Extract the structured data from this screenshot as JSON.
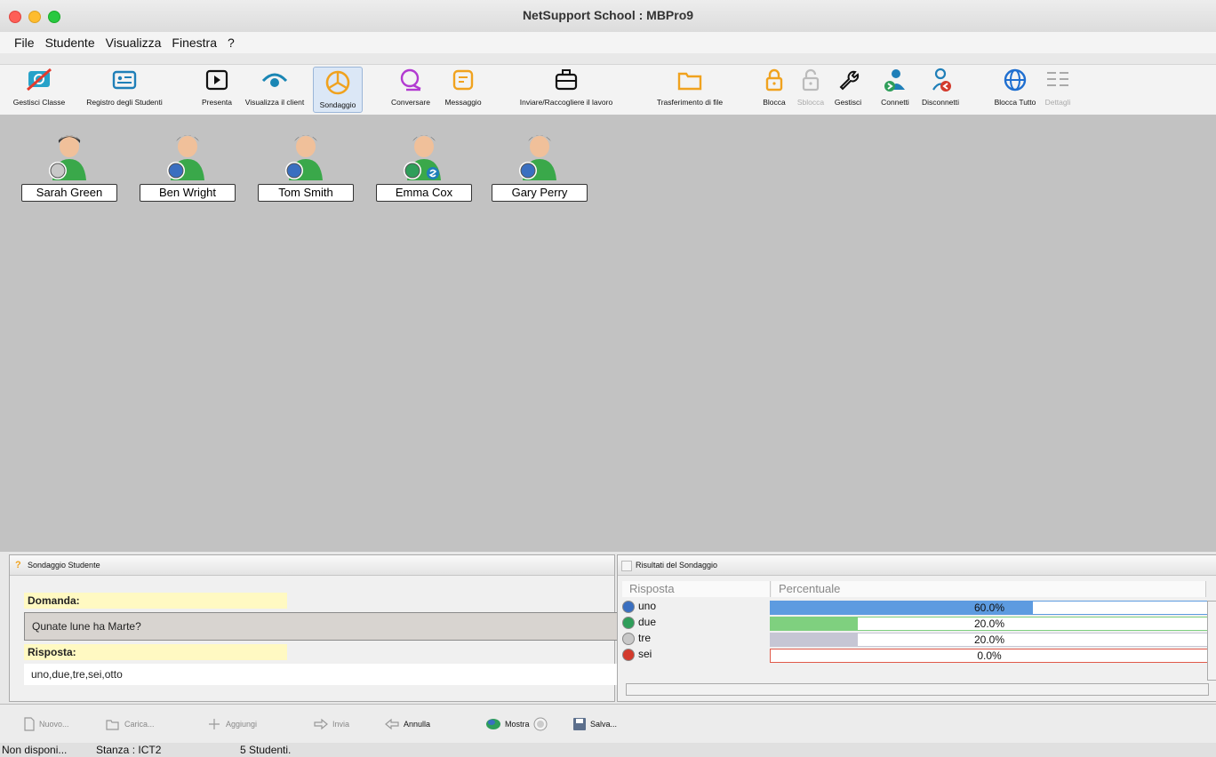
{
  "window": {
    "title": "NetSupport School : MBPro9"
  },
  "menu": [
    "File",
    "Studente",
    "Visualizza",
    "Finestra",
    "?"
  ],
  "toolbar": {
    "gestisci_classe": "Gestisci Classe",
    "registro": "Registro degli Studenti",
    "presenta": "Presenta",
    "visualizza_client": "Visualizza il client",
    "sondaggio": "Sondaggio",
    "conversare": "Conversare",
    "messaggio": "Messaggio",
    "inviare": "Inviare/Raccogliere il lavoro",
    "trasferimento": "Trasferimento di file",
    "blocca": "Blocca",
    "sblocca": "Sblocca",
    "gestisci": "Gestisci",
    "connetti": "Connetti",
    "disconnetti": "Disconnetti",
    "blocca_tutto": "Blocca Tutto",
    "dettagli": "Dettagli"
  },
  "students": [
    {
      "name": "Sarah Green",
      "answer_color": "#c8c8c8"
    },
    {
      "name": "Ben Wright",
      "answer_color": "#3a6fc0"
    },
    {
      "name": "Tom Smith",
      "answer_color": "#3a6fc0"
    },
    {
      "name": "Emma Cox",
      "answer_color": "#2f9e5a"
    },
    {
      "name": "Gary Perry",
      "answer_color": "#3a6fc0"
    }
  ],
  "survey": {
    "panel_title": "Sondaggio Studente",
    "question_label": "Domanda:",
    "question": "Qunate lune ha Marte?",
    "answer_label": "Risposta:",
    "answers": "uno,due,tre,sei,otto"
  },
  "results": {
    "panel_title": "Risultati del Sondaggio",
    "col_answer": "Risposta",
    "col_percent": "Percentuale",
    "rows": [
      {
        "answer": "uno",
        "percent": "60.0%",
        "fraction": 0.6,
        "color": "#5d9be0",
        "dot": "#3a6fc0"
      },
      {
        "answer": "due",
        "percent": "20.0%",
        "fraction": 0.2,
        "color": "#7fd07f",
        "dot": "#2f9e5a"
      },
      {
        "answer": "tre",
        "percent": "20.0%",
        "fraction": 0.2,
        "color": "#c6c6d4",
        "dot": "#c8c8c8"
      },
      {
        "answer": "sei",
        "percent": "0.0%",
        "fraction": 0.0,
        "color": "#e05a4a",
        "dot": "#d33a2c"
      }
    ]
  },
  "bottom": {
    "nuovo": "Nuovo...",
    "carica": "Carica...",
    "aggiungi": "Aggiungi",
    "invia": "Invia",
    "annulla": "Annulla",
    "mostra": "Mostra",
    "salva": "Salva..."
  },
  "status": {
    "availability": "Non disponi...",
    "room": "Stanza : ICT2",
    "count": "5 Studenti."
  }
}
